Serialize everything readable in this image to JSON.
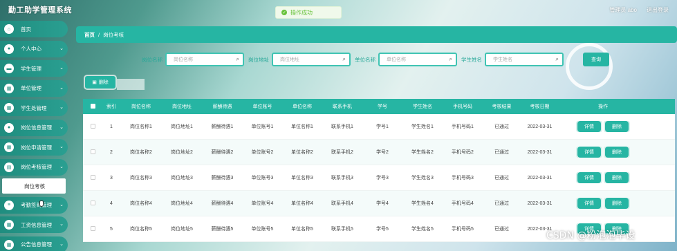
{
  "app_title": "勤工助学管理系统",
  "top_right": {
    "user": "管理员 abo",
    "logout": "退出登录"
  },
  "toast": "操作成功",
  "sidebar": {
    "items": [
      {
        "label": "首页",
        "icon": "home-icon",
        "chevron": false
      },
      {
        "label": "个人中心",
        "icon": "user-icon",
        "chevron": true
      },
      {
        "label": "学生管理",
        "icon": "student-icon",
        "chevron": true
      },
      {
        "label": "单位管理",
        "icon": "grid-icon",
        "chevron": true
      },
      {
        "label": "学生处管理",
        "icon": "grid-icon",
        "chevron": true
      },
      {
        "label": "岗位信息管理",
        "icon": "user-icon",
        "chevron": true
      },
      {
        "label": "岗位申请管理",
        "icon": "grid-icon",
        "chevron": true
      },
      {
        "label": "岗位考核管理",
        "icon": "list-icon",
        "chevron": true
      }
    ],
    "active_sub": "岗位考核",
    "items_after": [
      {
        "label": "考勤签到管理",
        "icon": "menu-icon",
        "chevron": true
      },
      {
        "label": "工资信息管理",
        "icon": "grid-icon",
        "chevron": true
      },
      {
        "label": "公告信息管理",
        "icon": "grid-icon",
        "chevron": true
      }
    ]
  },
  "breadcrumb": {
    "home": "首页",
    "sep": "/",
    "current": "岗位考核"
  },
  "search": {
    "fields": [
      {
        "label": "岗位名称",
        "placeholder": "岗位名称"
      },
      {
        "label": "岗位地址",
        "placeholder": "岗位地址"
      },
      {
        "label": "单位名称",
        "placeholder": "单位名称"
      },
      {
        "label": "学生姓名",
        "placeholder": "学生姓名"
      }
    ],
    "query_button": "查询"
  },
  "toolbar": {
    "delete_button": "删除"
  },
  "table": {
    "headers": [
      "索引",
      "岗位名称",
      "岗位地址",
      "薪酬待遇",
      "单位账号",
      "单位名称",
      "联系手机",
      "学号",
      "学生姓名",
      "手机号码",
      "考核结果",
      "考核日期",
      "操作"
    ],
    "rows": [
      [
        "1",
        "岗位名称1",
        "岗位地址1",
        "薪酬待遇1",
        "单位账号1",
        "单位名称1",
        "联系手机1",
        "学号1",
        "学生姓名1",
        "手机号码1",
        "已通过",
        "2022-03-31"
      ],
      [
        "2",
        "岗位名称2",
        "岗位地址2",
        "薪酬待遇2",
        "单位账号2",
        "单位名称2",
        "联系手机2",
        "学号2",
        "学生姓名2",
        "手机号码2",
        "已通过",
        "2022-03-31"
      ],
      [
        "3",
        "岗位名称3",
        "岗位地址3",
        "薪酬待遇3",
        "单位账号3",
        "单位名称3",
        "联系手机3",
        "学号3",
        "学生姓名3",
        "手机号码3",
        "已通过",
        "2022-03-31"
      ],
      [
        "4",
        "岗位名称4",
        "岗位地址4",
        "薪酬待遇4",
        "单位账号4",
        "单位名称4",
        "联系手机4",
        "学号4",
        "学生姓名4",
        "手机号码4",
        "已通过",
        "2022-03-31"
      ],
      [
        "5",
        "岗位名称5",
        "岗位地址5",
        "薪酬待遇5",
        "单位账号5",
        "单位名称5",
        "联系手机5",
        "学号5",
        "学生姓名5",
        "手机号码5",
        "已通过",
        "2022-03-31"
      ]
    ],
    "row_actions": {
      "detail": "详情",
      "delete": "删除"
    }
  },
  "watermark": "CSDN @粉泡泡毕设",
  "colors": {
    "accent": "#26b5a3",
    "sidebar": "#1f8d7f",
    "success": "#67c23a"
  }
}
